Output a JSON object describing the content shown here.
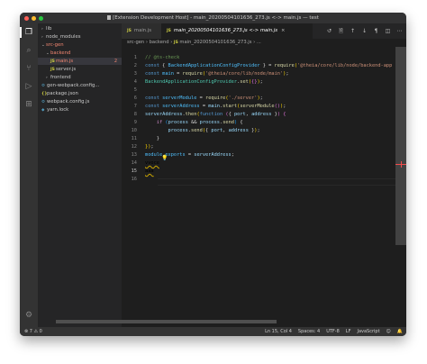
{
  "window": {
    "title": "[Extension Development Host] - main_20200504101636_273.js <-> main.js — test"
  },
  "activity": {
    "items": [
      "explorer-icon",
      "search-icon",
      "source-control-icon",
      "debug-icon",
      "extensions-icon"
    ],
    "settings": "gear-icon"
  },
  "explorer": {
    "rows": [
      {
        "label": "lib",
        "indent": 0,
        "chevron": ">",
        "type": "folder",
        "color": "normal"
      },
      {
        "label": "node_modules",
        "indent": 0,
        "chevron": ">",
        "type": "folder",
        "color": "normal"
      },
      {
        "label": "src-gen",
        "indent": 0,
        "chevron": "v",
        "type": "folder",
        "color": "red"
      },
      {
        "label": "backend",
        "indent": 1,
        "chevron": "v",
        "type": "folder",
        "color": "red"
      },
      {
        "label": "main.js",
        "indent": 2,
        "chevron": "",
        "type": "js",
        "color": "red",
        "badge": "2",
        "selected": true
      },
      {
        "label": "server.js",
        "indent": 2,
        "chevron": "",
        "type": "js",
        "color": "normal"
      },
      {
        "label": "frontend",
        "indent": 1,
        "chevron": ">",
        "type": "folder",
        "color": "normal"
      },
      {
        "label": "gen-webpack.config...",
        "indent": 0,
        "chevron": "",
        "type": "cfg",
        "color": "normal"
      },
      {
        "label": "package.json",
        "indent": 0,
        "chevron": "",
        "type": "json",
        "color": "normal"
      },
      {
        "label": "webpack.config.js",
        "indent": 0,
        "chevron": "",
        "type": "cfg",
        "color": "normal"
      },
      {
        "label": "yarn.lock",
        "indent": 0,
        "chevron": "",
        "type": "yarn",
        "color": "normal"
      }
    ]
  },
  "tabs": [
    {
      "label": "main.js",
      "active": false
    },
    {
      "label": "main_20200504101636_273.js <-> main.js",
      "active": true
    }
  ],
  "breadcrumb": {
    "parts": [
      "src-gen",
      "backend",
      "main_20200504101636_273.js",
      "..."
    ]
  },
  "editor": {
    "cursor_line": 15,
    "lines": [
      [
        [
          "cm",
          "// @ts-check"
        ]
      ],
      [
        [
          "kw",
          "const"
        ],
        [
          "code",
          " { "
        ],
        [
          "var",
          "BackendApplicationConfigProvider"
        ],
        [
          "code",
          " } = "
        ],
        [
          "fn",
          "require"
        ],
        [
          "yellowb",
          "("
        ],
        [
          "str",
          "'@theia/core/lib/node/backend-app"
        ]
      ],
      [
        [
          "kw",
          "const"
        ],
        [
          "code",
          " "
        ],
        [
          "var",
          "main"
        ],
        [
          "code",
          " = "
        ],
        [
          "fn",
          "require"
        ],
        [
          "yellowb",
          "("
        ],
        [
          "str",
          "'@theia/core/lib/node/main'"
        ],
        [
          "yellowb",
          ")"
        ],
        [
          "code",
          ";"
        ]
      ],
      [
        [
          "cls",
          "BackendApplicationConfigProvider"
        ],
        [
          "code",
          "."
        ],
        [
          "fn",
          "set"
        ],
        [
          "yellowb",
          "("
        ],
        [
          "pinkb",
          "{}"
        ],
        [
          "yellowb",
          ")"
        ],
        [
          "code",
          ";"
        ]
      ],
      [
        [
          "code",
          ""
        ]
      ],
      [
        [
          "kw",
          "const"
        ],
        [
          "code",
          " "
        ],
        [
          "var",
          "serverModule"
        ],
        [
          "code",
          " = "
        ],
        [
          "fn",
          "require"
        ],
        [
          "yellowb",
          "("
        ],
        [
          "str",
          "'./server'"
        ],
        [
          "yellowb",
          ")"
        ],
        [
          "code",
          ";"
        ]
      ],
      [
        [
          "kw",
          "const"
        ],
        [
          "code",
          " "
        ],
        [
          "var",
          "serverAddress"
        ],
        [
          "code",
          " = "
        ],
        [
          "prop",
          "main"
        ],
        [
          "code",
          "."
        ],
        [
          "fn",
          "start"
        ],
        [
          "yellowb",
          "("
        ],
        [
          "fn",
          "serverModule"
        ],
        [
          "pinkb",
          "()"
        ],
        [
          "yellowb",
          ")"
        ],
        [
          "code",
          ";"
        ]
      ],
      [
        [
          "prop",
          "serverAddress"
        ],
        [
          "code",
          "."
        ],
        [
          "fn",
          "then"
        ],
        [
          "yellowb",
          "("
        ],
        [
          "kw",
          "function"
        ],
        [
          "code",
          " "
        ],
        [
          "pinkb",
          "("
        ],
        [
          "code",
          "{ "
        ],
        [
          "prop",
          "port"
        ],
        [
          "code",
          ", "
        ],
        [
          "prop",
          "address"
        ],
        [
          "code",
          " }"
        ],
        [
          "pinkb",
          ")"
        ],
        [
          "code",
          " "
        ],
        [
          "pinkb",
          "{"
        ]
      ],
      [
        [
          "code",
          "    "
        ],
        [
          "ctl",
          "if"
        ],
        [
          "code",
          " "
        ],
        [
          "blueb",
          "("
        ],
        [
          "prop",
          "process"
        ],
        [
          "code",
          " && "
        ],
        [
          "prop",
          "process"
        ],
        [
          "code",
          "."
        ],
        [
          "fn",
          "send"
        ],
        [
          "blueb",
          ")"
        ],
        [
          "code",
          " {"
        ]
      ],
      [
        [
          "code",
          "        "
        ],
        [
          "prop",
          "process"
        ],
        [
          "code",
          "."
        ],
        [
          "fn",
          "send"
        ],
        [
          "yellowb",
          "("
        ],
        [
          "code",
          "{ "
        ],
        [
          "prop",
          "port"
        ],
        [
          "code",
          ", "
        ],
        [
          "prop",
          "address"
        ],
        [
          "code",
          " }"
        ],
        [
          "yellowb",
          ")"
        ],
        [
          "code",
          ";"
        ]
      ],
      [
        [
          "code",
          "    }"
        ]
      ],
      [
        [
          "yellowb",
          "}"
        ],
        [
          "yellowb",
          ")"
        ],
        [
          "code",
          ";"
        ]
      ],
      [
        [
          "var",
          "module"
        ],
        [
          "code",
          "."
        ],
        [
          "var",
          "exports"
        ],
        [
          "code",
          " = "
        ],
        [
          "prop",
          "serverAddress"
        ],
        [
          "code",
          ";"
        ]
      ],
      [
        [
          "squig",
          "vvoce"
        ]
      ],
      [
        [
          "squig",
          "aaa"
        ]
      ],
      [
        [
          "code",
          ""
        ]
      ]
    ]
  },
  "status": {
    "errors": "7",
    "warnings": "0",
    "position": "Ln 15, Col 4",
    "spaces": "Spaces: 4",
    "encoding": "UTF-8",
    "eol": "LF",
    "language": "JavaScript"
  }
}
